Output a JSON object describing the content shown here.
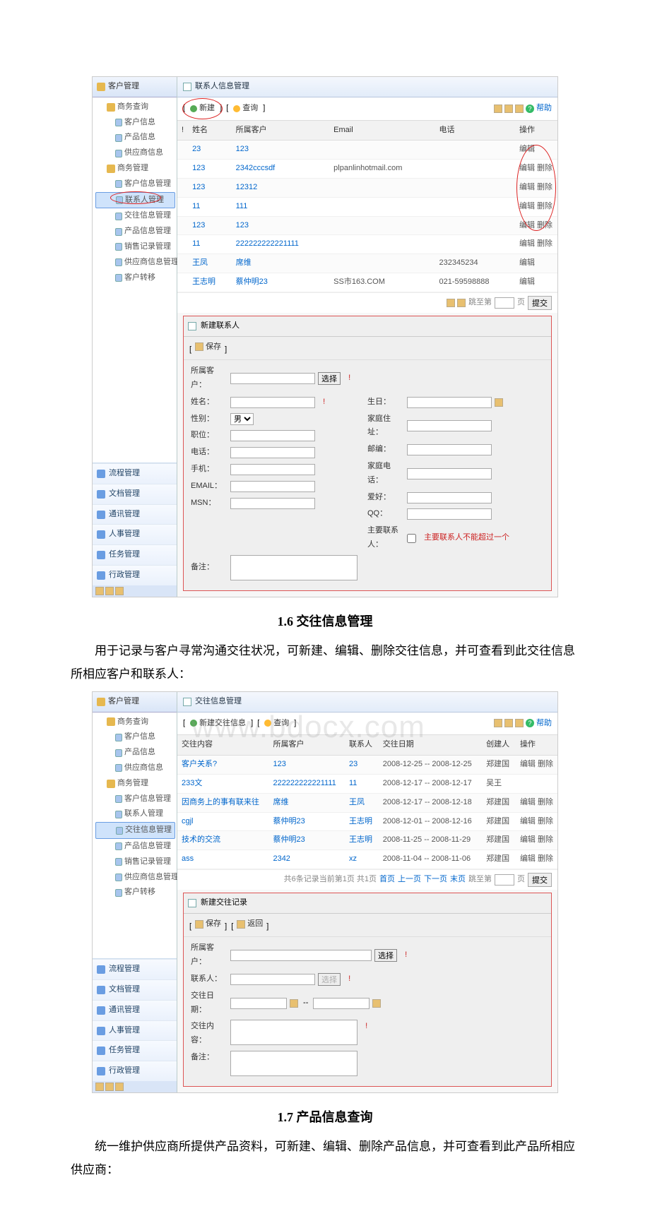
{
  "section_1_6": {
    "title": "1.6 交往信息管理",
    "body": "用于记录与客户寻常沟通交往状况，可新建、编辑、删除交往信息，并可查看到此交往信息所相应客户和联系人："
  },
  "section_1_7": {
    "title": "1.7 产品信息查询",
    "body": "统一维护供应商所提供产品资料，可新建、编辑、删除产品信息，并可查看到此产品所相应供应商："
  },
  "screenshot1": {
    "sidebar_title": "客户管理",
    "tree_query_root": "商务查询",
    "tree_query": [
      "客户信息",
      "产品信息",
      "供应商信息"
    ],
    "tree_manage_root": "商务管理",
    "tree_manage": [
      "客户信息管理",
      "联系人管理",
      "交往信息管理",
      "产品信息管理",
      "销售记录管理",
      "供应商信息管理",
      "客户转移"
    ],
    "selected_index": 1,
    "side_links": [
      "流程管理",
      "文档管理",
      "通讯管理",
      "人事管理",
      "任务管理",
      "行政管理"
    ],
    "panel_title": "联系人信息管理",
    "tb_new": "新建",
    "tb_search": "查询",
    "help": "帮助",
    "headers": {
      "mark": "!",
      "name": "姓名",
      "customer": "所属客户",
      "email": "Email",
      "phone": "电话",
      "ops": "操作"
    },
    "rows": [
      {
        "name": "23",
        "cust": "123",
        "email": "",
        "phone": "",
        "ops": "编辑"
      },
      {
        "name": "123",
        "cust": "2342cccsdf",
        "email": "plpanlinhotmail.com",
        "phone": "",
        "ops": "编辑 删除"
      },
      {
        "name": "123",
        "cust": "12312",
        "email": "",
        "phone": "",
        "ops": "编辑 删除"
      },
      {
        "name": "11",
        "cust": "111",
        "email": "",
        "phone": "",
        "ops": "编辑 删除"
      },
      {
        "name": "123",
        "cust": "123",
        "email": "",
        "phone": "",
        "ops": "编辑 删除"
      },
      {
        "name": "11",
        "cust": "222222222221111",
        "email": "",
        "phone": "",
        "ops": "编辑 删除"
      },
      {
        "name": "王凤",
        "cust": "席维",
        "email": "",
        "phone": "232345234",
        "ops": "编辑"
      },
      {
        "name": "王志明",
        "cust": "蔡仲明23",
        "email": "SS市163.COM",
        "phone": "021-59598888",
        "ops": "编辑"
      }
    ],
    "page_jump": "跳至第",
    "page_unit": "页",
    "page_submit": "提交",
    "form": {
      "title": "新建联系人",
      "save": "保存",
      "fields": {
        "customer": "所属客户：",
        "select_btn": "选择",
        "name": "姓名：",
        "birth": "生日：",
        "gender": "性别：",
        "gender_val": "男",
        "addr": "家庭住址：",
        "post": "职位：",
        "postal": "邮编：",
        "tel": "电话：",
        "hometel": "家庭电话：",
        "mobile": "手机：",
        "hobby": "爱好：",
        "email": "EMAIL：",
        "qq": "QQ：",
        "msn": "MSN：",
        "main_contact": "主要联系人：",
        "main_contact_hint": "主要联系人不能超过一个",
        "remark": "备注："
      }
    }
  },
  "screenshot2": {
    "sidebar_title": "客户管理",
    "tree_query_root": "商务查询",
    "tree_query": [
      "客户信息",
      "产品信息",
      "供应商信息"
    ],
    "tree_manage_root": "商务管理",
    "tree_manage": [
      "客户信息管理",
      "联系人管理",
      "交往信息管理",
      "产品信息管理",
      "销售记录管理",
      "供应商信息管理",
      "客户转移"
    ],
    "selected_index": 2,
    "side_links": [
      "流程管理",
      "文档管理",
      "通讯管理",
      "人事管理",
      "任务管理",
      "行政管理"
    ],
    "panel_title": "交往信息管理",
    "tb_new_full": "新建交往信息",
    "tb_search": "查询",
    "help": "帮助",
    "headers": {
      "content": "交往内容",
      "customer": "所属客户",
      "contact": "联系人",
      "date": "交往日期",
      "creator": "创建人",
      "ops": "操作"
    },
    "rows": [
      {
        "content": "客户关系?",
        "cust": "123",
        "contact": "23",
        "date": "2008-12-25 -- 2008-12-25",
        "creator": "郑建国",
        "ops": "编辑 删除"
      },
      {
        "content": "233文",
        "cust": "222222222221111",
        "contact": "11",
        "date": "2008-12-17 -- 2008-12-17",
        "creator": "吴王",
        "ops": ""
      },
      {
        "content": "因商务上的事有联来往",
        "cust": "席维",
        "contact": "王凤",
        "date": "2008-12-17 -- 2008-12-18",
        "creator": "郑建国",
        "ops": "编辑 删除"
      },
      {
        "content": "cgjl",
        "cust": "蔡仲明23",
        "contact": "王志明",
        "date": "2008-12-01 -- 2008-12-16",
        "creator": "郑建国",
        "ops": "编辑 删除"
      },
      {
        "content": "技术的交流",
        "cust": "蔡仲明23",
        "contact": "王志明",
        "date": "2008-11-25 -- 2008-11-29",
        "creator": "郑建国",
        "ops": "编辑 删除"
      },
      {
        "content": "ass",
        "cust": "2342",
        "contact": "xz",
        "date": "2008-11-04 -- 2008-11-06",
        "creator": "郑建国",
        "ops": "编辑 删除"
      }
    ],
    "pager_text": "共6条记录当前第1页 共1页",
    "first": "首页",
    "prev": "上一页",
    "next": "下一页",
    "last": "末页",
    "page_jump": "跳至第",
    "page_unit": "页",
    "page_submit": "提交",
    "form": {
      "title": "新建交往记录",
      "save": "保存",
      "back": "返回",
      "fields": {
        "customer": "所属客户：",
        "select_btn": "选择",
        "contact": "联系人：",
        "choose": "选择",
        "date": "交往日期：",
        "content": "交往内容：",
        "remark": "备注："
      }
    },
    "watermark": "www.bdocx.com"
  }
}
